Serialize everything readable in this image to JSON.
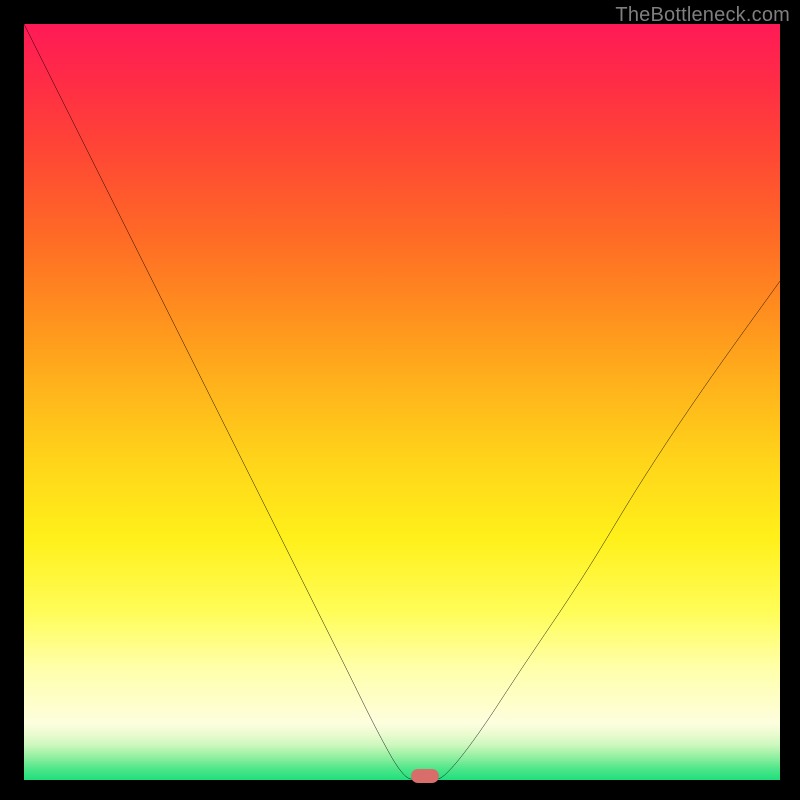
{
  "watermark": "TheBottleneck.com",
  "chart_data": {
    "type": "line",
    "title": "",
    "xlabel": "",
    "ylabel": "",
    "xlim": [
      0,
      100
    ],
    "ylim": [
      0,
      100
    ],
    "series": [
      {
        "name": "bottleneck-curve",
        "x": [
          0,
          6,
          12,
          18,
          24,
          30,
          36,
          42,
          47,
          50,
          52,
          54,
          56,
          60,
          66,
          74,
          82,
          90,
          100
        ],
        "y": [
          100,
          88,
          76,
          64,
          52,
          40,
          28,
          16,
          6,
          1,
          0,
          0,
          1,
          6,
          15,
          27,
          40,
          52,
          66
        ]
      }
    ],
    "marker": {
      "x": 53,
      "y": 0.5,
      "color": "#d86d6a"
    },
    "background_gradient": {
      "top": "#ff1a57",
      "mid": "#fff01a",
      "bottom": "#1fdf7c"
    }
  }
}
